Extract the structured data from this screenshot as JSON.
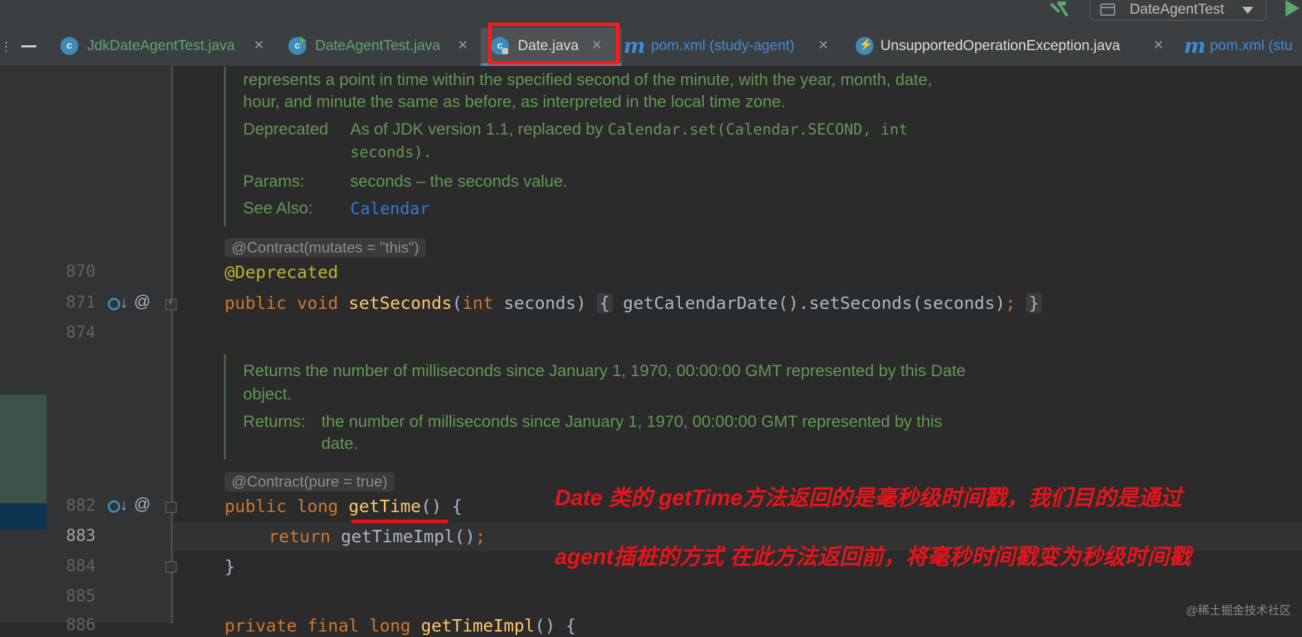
{
  "toolbar": {
    "run_config_label": "DateAgentTest"
  },
  "tabs": [
    {
      "label": "JdkDateAgentTest.java",
      "icon": "class-icon"
    },
    {
      "label": "DateAgentTest.java",
      "icon": "class-run-icon"
    },
    {
      "label": "Date.java",
      "icon": "class-locked-icon",
      "active": true
    },
    {
      "label": "pom.xml (study-agent)",
      "icon": "maven-icon"
    },
    {
      "label": "UnsupportedOperationException.java",
      "icon": "exception-class-icon"
    },
    {
      "label": "pom.xml (stu",
      "icon": "maven-icon"
    }
  ],
  "close_glyph": "×",
  "class_glyph": "c",
  "maven_glyph": "m",
  "gutter": {
    "line_numbers": [
      "870",
      "871",
      "874",
      "882",
      "883",
      "884",
      "885",
      "886"
    ],
    "at_glyph": "@",
    "arrow_glyph": "↓"
  },
  "doc1": {
    "line1": "represents a point in time within the specified second of the minute, with the year, month, date,",
    "line2": "hour, and minute the same as before, as interpreted in the local time zone.",
    "deprecated_label": "Deprecated",
    "deprecated_text": "As of JDK version 1.1, replaced by",
    "deprecated_code1": "Calendar.set(Calendar.SECOND, int",
    "deprecated_code2": "seconds).",
    "params_label": "Params:",
    "params_text": "seconds – the seconds value.",
    "see_label": "See Also:",
    "see_link": "Calendar"
  },
  "inlay1": "@Contract(mutates = \"this\")",
  "code": {
    "l870": "@Deprecated",
    "l871_public": "public",
    "l871_void": "void",
    "l871_name": "setSeconds",
    "l871_paren": "(",
    "l871_int": "int",
    "l871_param": " seconds)",
    "l871_lbrace": "{",
    "l871_body": "getCalendarDate().setSeconds(seconds)",
    "l871_semi": ";",
    "l871_rbrace": "}",
    "l882_public": "public",
    "l882_long": "long",
    "l882_name": "getTime",
    "l882_rest": "() {",
    "l883_return": "return",
    "l883_body": " getTimeImpl()",
    "l883_semi": ";",
    "l884": "}",
    "l886_partial": "private final long getTimeImpl() {"
  },
  "doc2": {
    "line1": "Returns the number of milliseconds since January 1, 1970, 00:00:00 GMT represented by this Date",
    "line2": "object.",
    "returns_label": "Returns:",
    "returns_text1": "the number of milliseconds since January 1, 1970, 00:00:00 GMT represented by this",
    "returns_text2": "date."
  },
  "inlay2": "@Contract(pure = true)",
  "annotation_note": {
    "line1": "Date 类的 getTime方法返回的是毫秒级时间戳，我们目的是通过",
    "line2": "agent插桩的方式 在此方法返回前，将毫秒时间戳变为秒级时间戳",
    "color": "#e8141b"
  },
  "watermark": "@稀土掘金技术社区"
}
